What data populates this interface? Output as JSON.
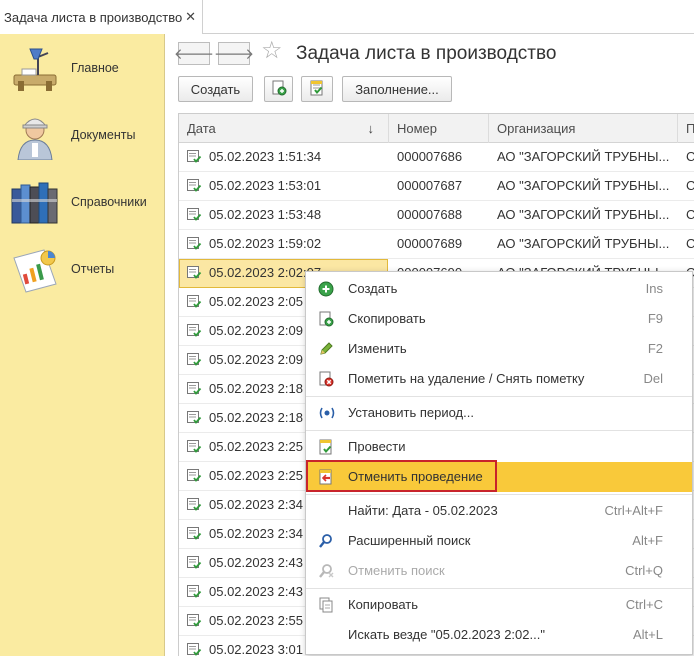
{
  "tab": {
    "label": "Задача листа в производство",
    "close": "✕"
  },
  "sidebar": {
    "items": [
      {
        "label": "Главное",
        "icon": "desk-lamp-icon"
      },
      {
        "label": "Документы",
        "icon": "worker-icon"
      },
      {
        "label": "Справочники",
        "icon": "books-icon"
      },
      {
        "label": "Отчеты",
        "icon": "report-chart-icon"
      }
    ]
  },
  "header": {
    "title": "Задача листа в производство",
    "back": "🡐",
    "forward": "🡒",
    "star": "☆"
  },
  "toolbar": {
    "create": "Создать",
    "fill": "Заполнение..."
  },
  "table": {
    "columns": [
      "Дата",
      "Номер",
      "Организация",
      "П"
    ],
    "sort_arrow": "↓",
    "rows": [
      {
        "date": "05.02.2023 1:51:34",
        "number": "000007686",
        "org": "АО \"ЗАГОРСКИЙ ТРУБНЫ...",
        "ext": "С"
      },
      {
        "date": "05.02.2023 1:53:01",
        "number": "000007687",
        "org": "АО \"ЗАГОРСКИЙ ТРУБНЫ...",
        "ext": "С"
      },
      {
        "date": "05.02.2023 1:53:48",
        "number": "000007688",
        "org": "АО \"ЗАГОРСКИЙ ТРУБНЫ...",
        "ext": "С"
      },
      {
        "date": "05.02.2023 1:59:02",
        "number": "000007689",
        "org": "АО \"ЗАГОРСКИЙ ТРУБНЫ...",
        "ext": "С"
      },
      {
        "date": "05.02.2023 2:02:07",
        "number": "000007690",
        "org": "АО \"ЗАГОРСКИЙ ТРУБНЫ...",
        "ext": "С"
      },
      {
        "date": "05.02.2023 2:05",
        "number": "",
        "org": "",
        "ext": ""
      },
      {
        "date": "05.02.2023 2:09",
        "number": "",
        "org": "",
        "ext": ""
      },
      {
        "date": "05.02.2023 2:09",
        "number": "",
        "org": "",
        "ext": ""
      },
      {
        "date": "05.02.2023 2:18",
        "number": "",
        "org": "",
        "ext": ""
      },
      {
        "date": "05.02.2023 2:18",
        "number": "",
        "org": "",
        "ext": ""
      },
      {
        "date": "05.02.2023 2:25",
        "number": "",
        "org": "",
        "ext": ""
      },
      {
        "date": "05.02.2023 2:25",
        "number": "",
        "org": "",
        "ext": ""
      },
      {
        "date": "05.02.2023 2:34",
        "number": "",
        "org": "",
        "ext": ""
      },
      {
        "date": "05.02.2023 2:34",
        "number": "",
        "org": "",
        "ext": ""
      },
      {
        "date": "05.02.2023 2:43",
        "number": "",
        "org": "",
        "ext": ""
      },
      {
        "date": "05.02.2023 2:43",
        "number": "",
        "org": "",
        "ext": ""
      },
      {
        "date": "05.02.2023 2:55",
        "number": "",
        "org": "",
        "ext": ""
      },
      {
        "date": "05.02.2023 3:01",
        "number": "",
        "org": "",
        "ext": ""
      }
    ]
  },
  "context_menu": {
    "items": [
      {
        "label": "Создать",
        "key": "Ins",
        "icon": "plus-circle-icon"
      },
      {
        "label": "Скопировать",
        "key": "F9",
        "icon": "copy-document-icon"
      },
      {
        "label": "Изменить",
        "key": "F2",
        "icon": "pencil-icon"
      },
      {
        "label": "Пометить на удаление / Снять пометку",
        "key": "Del",
        "icon": "delete-mark-icon"
      },
      {
        "label": "Установить период...",
        "key": "",
        "icon": "period-icon"
      },
      {
        "label": "Провести",
        "key": "",
        "icon": "post-document-icon"
      },
      {
        "label": "Отменить проведение",
        "key": "",
        "icon": "unpost-document-icon"
      },
      {
        "label": "Найти: Дата - 05.02.2023",
        "key": "Ctrl+Alt+F",
        "icon": ""
      },
      {
        "label": "Расширенный поиск",
        "key": "Alt+F",
        "icon": "search-icon"
      },
      {
        "label": "Отменить поиск",
        "key": "Ctrl+Q",
        "icon": "cancel-search-icon"
      },
      {
        "label": "Копировать",
        "key": "Ctrl+C",
        "icon": "copy-icon"
      },
      {
        "label": "Искать везде \"05.02.2023 2:02...\"",
        "key": "Alt+L",
        "icon": ""
      }
    ]
  },
  "colors": {
    "sidebar_bg": "#faeba1",
    "highlight": "#f9c93a",
    "selection_border": "#c8242b"
  }
}
